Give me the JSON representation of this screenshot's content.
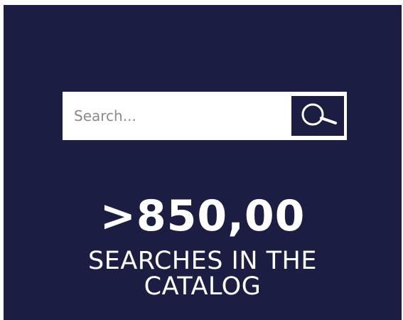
{
  "search": {
    "placeholder": "Search..."
  },
  "stats": {
    "value": ">850,00",
    "caption": "SEARCHES IN THE CATALOG"
  },
  "colors": {
    "background": "#1b1e42",
    "search_button": "#1b1e42",
    "text": "#ffffff"
  },
  "icons": {
    "search_button": "magnifying-glass"
  }
}
